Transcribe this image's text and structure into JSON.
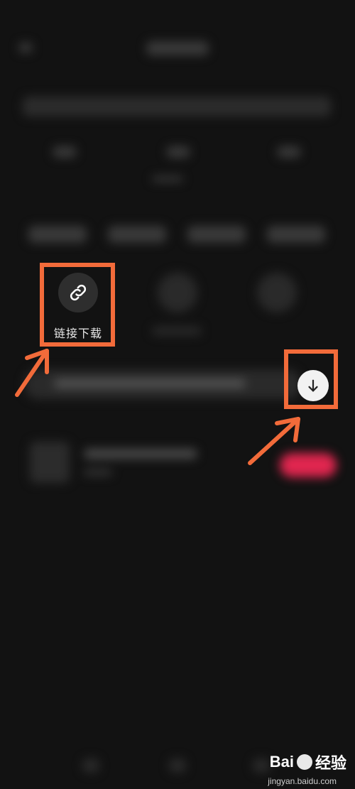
{
  "link_download": {
    "label": "链接下载"
  },
  "watermark": {
    "brand": "Bai",
    "brand_suffix": "经验",
    "url": "jingyan.baidu.com"
  },
  "colors": {
    "highlight": "#f26b3a",
    "background": "#121212",
    "accent_pill": "#e0264f"
  }
}
